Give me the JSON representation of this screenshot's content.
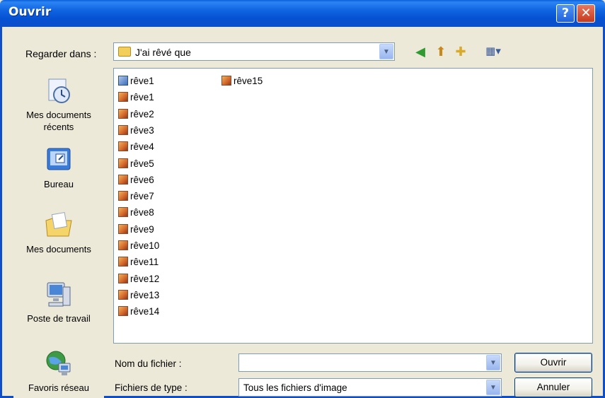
{
  "window": {
    "title": "Ouvrir",
    "help_glyph": "?",
    "close_glyph": "✕"
  },
  "lookin": {
    "label": "Regarder dans :",
    "value": "J'ai rêvé que"
  },
  "toolbar": {
    "back_icon": "back-icon",
    "up_icon": "up-folder-icon",
    "new_folder_icon": "new-folder-icon",
    "views_icon": "views-menu-icon"
  },
  "places": [
    {
      "label": "Mes documents récents",
      "icon": "recent-documents-icon"
    },
    {
      "label": "Bureau",
      "icon": "desktop-icon"
    },
    {
      "label": "Mes documents",
      "icon": "my-documents-icon"
    },
    {
      "label": "Poste de travail",
      "icon": "my-computer-icon"
    },
    {
      "label": "Favoris réseau",
      "icon": "network-places-icon"
    }
  ],
  "files": [
    {
      "name": "rêve1",
      "type": "shortcut"
    },
    {
      "name": "rêve1",
      "type": "image"
    },
    {
      "name": "rêve2",
      "type": "image"
    },
    {
      "name": "rêve3",
      "type": "image"
    },
    {
      "name": "rêve4",
      "type": "image"
    },
    {
      "name": "rêve5",
      "type": "image"
    },
    {
      "name": "rêve6",
      "type": "image"
    },
    {
      "name": "rêve7",
      "type": "image"
    },
    {
      "name": "rêve8",
      "type": "image"
    },
    {
      "name": "rêve9",
      "type": "image"
    },
    {
      "name": "rêve10",
      "type": "image"
    },
    {
      "name": "rêve11",
      "type": "image"
    },
    {
      "name": "rêve12",
      "type": "image"
    },
    {
      "name": "rêve13",
      "type": "image"
    },
    {
      "name": "rêve14",
      "type": "image"
    },
    {
      "name": "rêve15",
      "type": "image"
    }
  ],
  "filename": {
    "label": "Nom du fichier :",
    "value": ""
  },
  "filetype": {
    "label": "Fichiers de type :",
    "value": "Tous les fichiers d'image"
  },
  "buttons": {
    "open": "Ouvrir",
    "cancel": "Annuler"
  },
  "colors": {
    "titlebar": "#0c4fc9",
    "dialog_bg": "#ece9d8",
    "field_border": "#7f9db9"
  }
}
